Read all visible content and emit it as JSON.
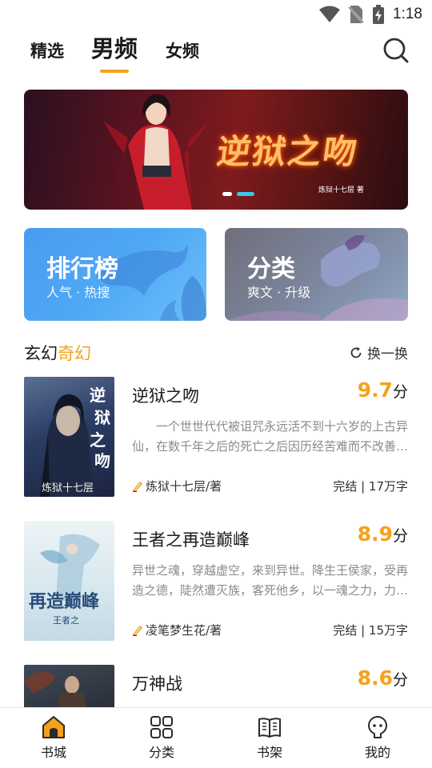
{
  "status_bar": {
    "time": "1:18"
  },
  "tabs": [
    {
      "label": "精选",
      "active": false
    },
    {
      "label": "男频",
      "active": true
    },
    {
      "label": "女频",
      "active": false
    }
  ],
  "accent_color": "#f5a21b",
  "banner": {
    "title": "逆狱之吻",
    "author": "炼狱十七层 著",
    "slide_count": 2,
    "active_slide": 2
  },
  "cards": {
    "ranking": {
      "title": "排行榜",
      "subtitle": "人气 · 热搜"
    },
    "category": {
      "title": "分类",
      "subtitle": "爽文 · 升级"
    }
  },
  "section": {
    "title_main": "玄幻",
    "title_accent": "奇幻",
    "refresh_label": "换一换"
  },
  "books": [
    {
      "title": "逆狱之吻",
      "score": "9.7",
      "score_unit": "分",
      "description": "一个世世代代被诅咒永远活不到十六岁的上古异仙，在数千年之后的死亡之后因历经苦难而不改善…",
      "author": "炼狱十七层/著",
      "meta": "完结 | 17万字",
      "cover_text": "逆狱之吻",
      "cover_author": "炼狱十七层"
    },
    {
      "title": "王者之再造巅峰",
      "score": "8.9",
      "score_unit": "分",
      "description": "异世之魂，穿越虚空，来到异世。降生王侯家，受再造之德，陡然遭灭族，客死他乡，以一魂之力，力…",
      "author": "凌笔梦生花/著",
      "meta": "完结 | 15万字",
      "cover_text": "再造巅峰",
      "cover_sub": "王者之"
    },
    {
      "title": "万神战",
      "score": "8.6",
      "score_unit": "分"
    }
  ],
  "bottom_nav": [
    {
      "label": "书城",
      "icon": "home-icon",
      "active": true
    },
    {
      "label": "分类",
      "icon": "grid-icon",
      "active": false
    },
    {
      "label": "书架",
      "icon": "book-icon",
      "active": false
    },
    {
      "label": "我的",
      "icon": "user-icon",
      "active": false
    }
  ]
}
